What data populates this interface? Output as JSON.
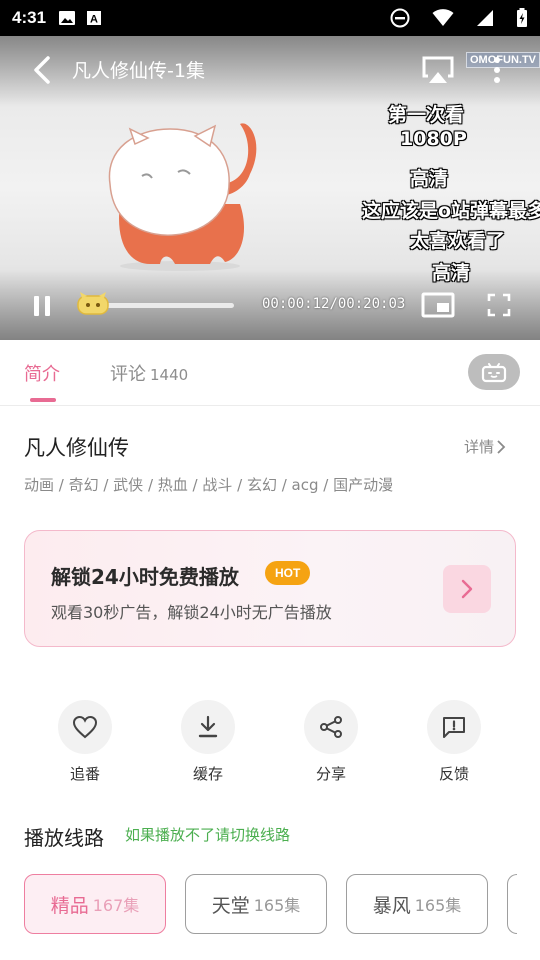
{
  "status_bar": {
    "time": "4:31",
    "icons": [
      "image-icon",
      "a-icon",
      "dnd-icon",
      "wifi-icon",
      "signal-icon",
      "battery-icon"
    ]
  },
  "player": {
    "title": "凡人修仙传-1集",
    "watermark": "OMOFUN.TV",
    "current_time": "00:00:12",
    "time_separator": "/",
    "total_time": "00:20:03",
    "progress": 0.01,
    "danmaku": [
      "第一次看",
      "1080P",
      "高清",
      "这应该是o站弹幕最多的了",
      "太喜欢看了",
      "高清"
    ]
  },
  "tabs": {
    "intro": "简介",
    "comments": "评论",
    "comments_count": "1440"
  },
  "show": {
    "title": "凡人修仙传",
    "details": "详情",
    "tags": "动画 / 奇幻 / 武侠 / 热血 / 战斗 / 玄幻 / acg / 国产动漫"
  },
  "promo": {
    "title": "解锁24小时免费播放",
    "badge": "HOT",
    "subtitle": "观看30秒广告，解锁24小时无广告播放"
  },
  "actions": [
    {
      "label": "追番",
      "icon": "heart-icon"
    },
    {
      "label": "缓存",
      "icon": "download-icon"
    },
    {
      "label": "分享",
      "icon": "share-icon"
    },
    {
      "label": "反馈",
      "icon": "feedback-icon"
    }
  ],
  "routes": {
    "title": "播放线路",
    "hint": "如果播放不了请切换线路",
    "items": [
      {
        "name": "精品",
        "count": "167集",
        "active": true
      },
      {
        "name": "天堂",
        "count": "165集",
        "active": false
      },
      {
        "name": "暴风",
        "count": "165集",
        "active": false
      }
    ]
  },
  "colors": {
    "accent": "#e86b93",
    "hot_badge": "#f5a312",
    "hint_green": "#4caf50"
  }
}
